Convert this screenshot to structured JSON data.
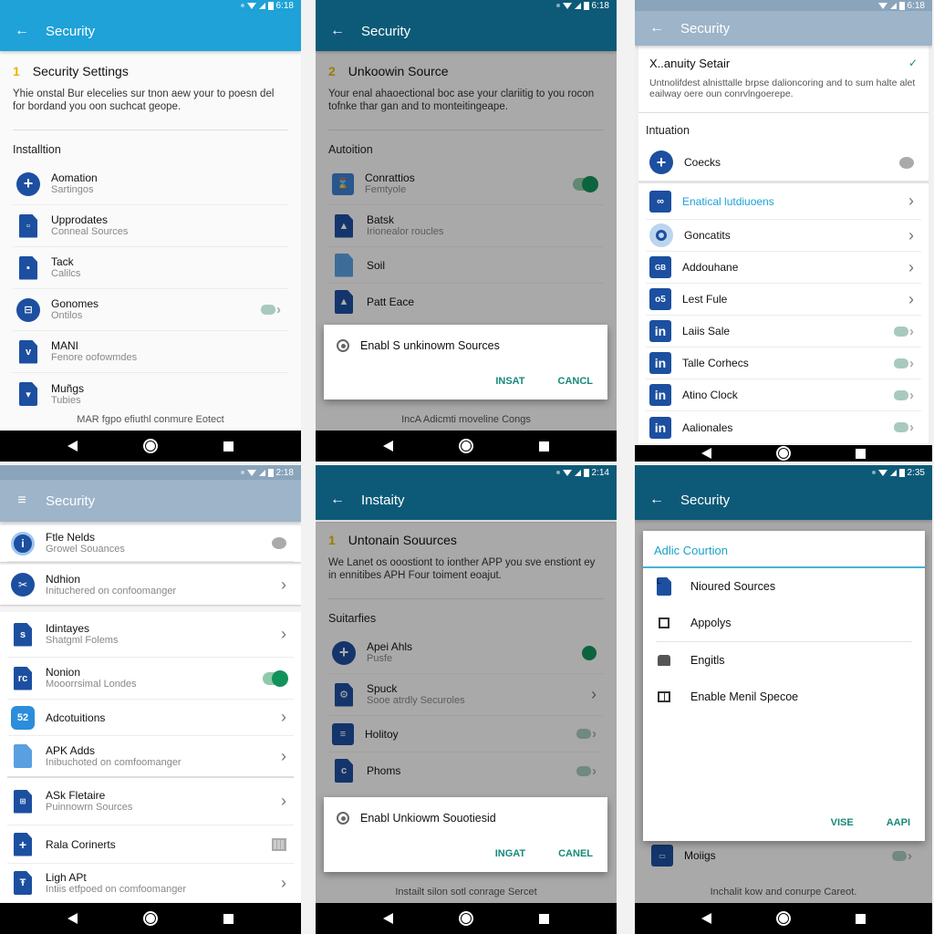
{
  "panels": {
    "p1": {
      "status_time": "6:18",
      "appbar_title": "Security",
      "nav_icon": "back-arrow-icon",
      "step_number": "1",
      "step_title": "Security Settings",
      "description": "Yhie onstal Bur elecelies sur tnon aew your to poesn del for bordand you oon suchcat geope.",
      "section": "Installtion",
      "rows": [
        {
          "title": "Aomation",
          "subtitle": "Sartingos",
          "icon": "plus-circle-icon",
          "trailing": ""
        },
        {
          "title": "Upprodates",
          "subtitle": "Conneal Sources",
          "icon": "document-icon",
          "trailing": ""
        },
        {
          "title": "Tack",
          "subtitle": "Calilcs",
          "icon": "document-icon",
          "trailing": ""
        },
        {
          "title": "Gonomes",
          "subtitle": "Ontilos",
          "icon": "grid-circle-icon",
          "trailing": "toggle-off"
        },
        {
          "title": "MANI",
          "subtitle": "Fenore oofowmdes",
          "icon": "document-icon",
          "trailing": ""
        },
        {
          "title": "Muñgs",
          "subtitle": "Tubies",
          "icon": "document-icon",
          "trailing": ""
        }
      ],
      "footnote": "MAR fgpo efiuthl conmure Eotect"
    },
    "p2": {
      "status_time": "6:18",
      "appbar_title": "Security",
      "nav_icon": "back-arrow-icon",
      "step_number": "2",
      "step_title": "Unkoowin Source",
      "description": "Your enal ahaoectional boc ase your clariitig to you rocon tofnke thar gan and to monteitingeape.",
      "section": "Autoition",
      "rows": [
        {
          "title": "Conrattios",
          "subtitle": "Femtyole",
          "icon": "hourglass-icon",
          "trailing": "toggle-on"
        },
        {
          "title": "Batsk",
          "subtitle": "Irionealor roucles",
          "icon": "document-icon",
          "trailing": ""
        },
        {
          "title": "Soil",
          "subtitle": "",
          "icon": "document-icon",
          "trailing": ""
        },
        {
          "title": "Patt Eace",
          "subtitle": "",
          "icon": "document-icon",
          "trailing": ""
        }
      ],
      "dialog": {
        "title": "Enabl S unkinowm Sources",
        "confirm": "INSAT",
        "cancel": "CANCL"
      },
      "footnote": "IncA Adicmti moveline Congs"
    },
    "p3": {
      "status_time": "6:18",
      "appbar_title": "Security",
      "nav_icon": "back-arrow-icon",
      "card_title": "X..anuity Setair",
      "card_desc": "Untnolifdest alnisttalle brpse dalioncoring and to sum halte alet eailway oere oun conrvlngoerepe.",
      "section": "Intuation",
      "first_row": {
        "title": "Coecks",
        "icon": "plus-circle-icon",
        "trailing": "chat-bubble"
      },
      "rows": [
        {
          "title": "Enatical lutdiuoens",
          "icon": "link-square-icon",
          "trailing": "chevron",
          "highlight": true
        },
        {
          "title": "Goncatits",
          "icon": "ring-icon",
          "trailing": "chevron"
        },
        {
          "title": "Addouhane",
          "icon": "square-icon",
          "trailing": "chevron"
        },
        {
          "title": "Lest Fule",
          "icon": "square-icon",
          "trailing": "chevron"
        },
        {
          "title": "Laiis Sale",
          "icon": "linkedin-icon",
          "trailing": "toggle-off"
        },
        {
          "title": "Talle Corhecs",
          "icon": "linkedin-icon",
          "trailing": "toggle-off"
        },
        {
          "title": "Atino Clock",
          "icon": "linkedin-icon",
          "trailing": "toggle-off"
        },
        {
          "title": "Aalionales",
          "icon": "linkedin-icon",
          "trailing": "toggle-off"
        }
      ]
    },
    "p4": {
      "status_time": "2:18",
      "appbar_title": "Security",
      "nav_icon": "menu-icon",
      "rows": [
        {
          "title": "Ftle Nelds",
          "subtitle": "Growel Souances",
          "icon": "info-circle-icon",
          "trailing": "chat-bubble"
        },
        {
          "title": "Ndhion",
          "subtitle": "Inituchered on confoomanger",
          "icon": "tools-circle-icon",
          "trailing": "chevron"
        },
        {
          "title": "Idintayes",
          "subtitle": "Shatgml Folems",
          "icon": "document-icon",
          "trailing": "chevron"
        },
        {
          "title": "Nonion",
          "subtitle": "Mooorrsimal Londes",
          "icon": "document-icon",
          "trailing": "toggle-on"
        },
        {
          "title": "Adcotuitions",
          "subtitle": "",
          "icon": "hex-icon",
          "trailing": "chevron"
        },
        {
          "title": "APK Adds",
          "subtitle": "Inibuchoted on comfoomanger",
          "icon": "document-icon",
          "trailing": "chevron"
        },
        {
          "title": "ASk Fletaire",
          "subtitle": "Puinnowrn Sources",
          "icon": "document-icon",
          "trailing": "chevron"
        },
        {
          "title": "Rala Corinerts",
          "subtitle": "",
          "icon": "document-icon",
          "trailing": "grid"
        },
        {
          "title": "Ligh APt",
          "subtitle": "Intiis etfpoed on comfoomanger",
          "icon": "document-icon",
          "trailing": "chevron"
        }
      ]
    },
    "p5": {
      "status_time": "2:14",
      "appbar_title": "Instaity",
      "nav_icon": "back-arrow-icon",
      "step_number": "1",
      "step_title": "Untonain Souurces",
      "description": "We Lanet os ooostiont to ionther APP you sve enstiont ey in ennitibes APH Four toiment eoajut.",
      "section": "Suitarfies",
      "rows": [
        {
          "title": "Apei Ahls",
          "subtitle": "Pusfe",
          "icon": "plus-circle-icon",
          "trailing": "green-dot"
        },
        {
          "title": "Spuck",
          "subtitle": "Sooe atrdly Securoles",
          "icon": "document-icon",
          "trailing": "chevron"
        },
        {
          "title": "Holitoy",
          "subtitle": "",
          "icon": "document-icon",
          "trailing": "toggle-off"
        },
        {
          "title": "Phoms",
          "subtitle": "",
          "icon": "document-icon",
          "trailing": "toggle-off"
        }
      ],
      "dialog": {
        "title": "Enabl Unkiowm Souotiesid",
        "confirm": "INGAT",
        "cancel": "CANEL"
      },
      "footnote": "Instailt silon sotl conrage Sercet"
    },
    "p6": {
      "status_time": "2:35",
      "appbar_title": "Security",
      "nav_icon": "back-arrow-icon",
      "dialog": {
        "title": "Adlic Courtion",
        "items": [
          {
            "label": "Nioured Sources",
            "icon": "document-icon"
          },
          {
            "label": "Appolys",
            "icon": "checkbox-icon"
          },
          {
            "label": "Engitls",
            "icon": "card-icon"
          },
          {
            "label": "Enable Menil Specoe",
            "icon": "grid-icon"
          }
        ],
        "actions": [
          "VISE",
          "AAPI"
        ]
      },
      "bg_row": {
        "title": "Moiigs",
        "trailing": "toggle-off"
      },
      "footnote": "Inchalit kow and conurpe Careot."
    }
  }
}
